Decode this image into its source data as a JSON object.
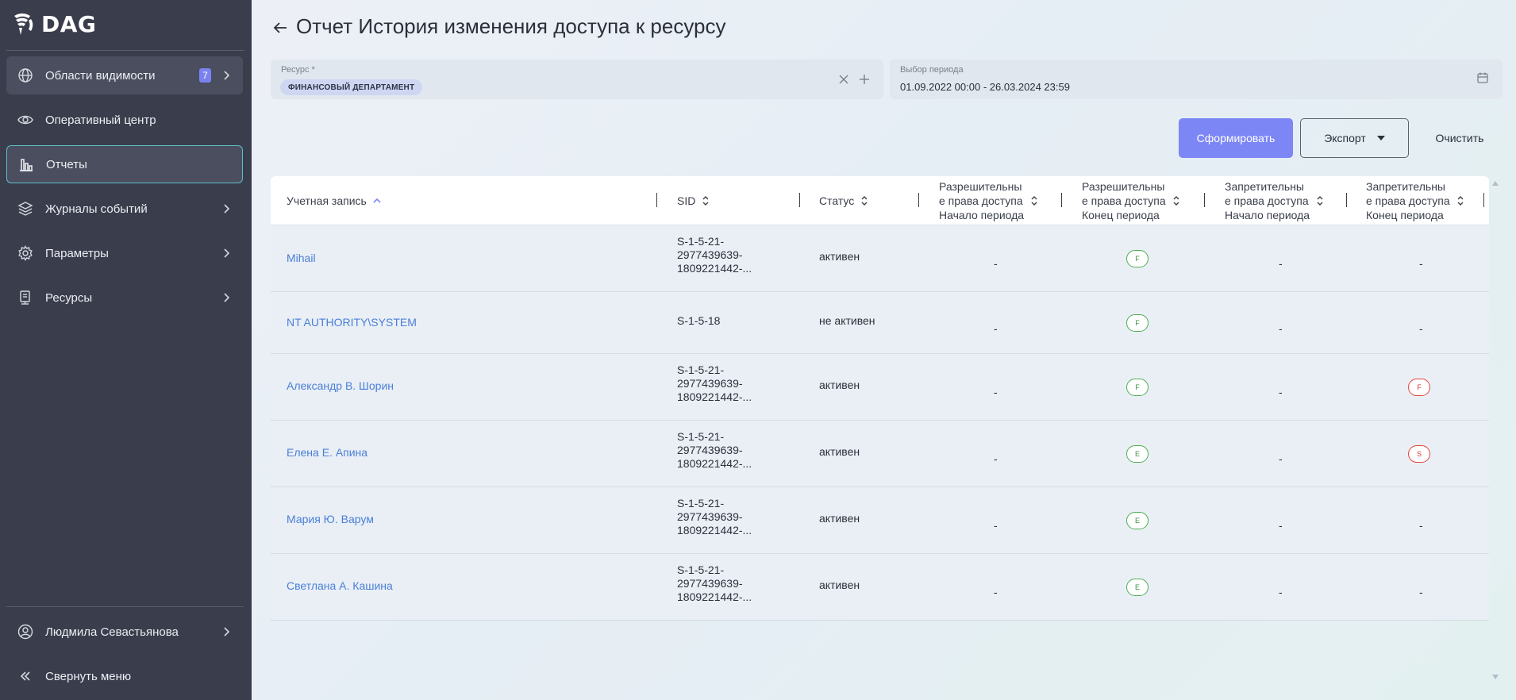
{
  "app": {
    "logo_text": "DAG"
  },
  "sidebar": {
    "items": [
      {
        "label": "Области видимости",
        "badge": "7"
      },
      {
        "label": "Оперативный центр"
      },
      {
        "label": "Отчеты"
      },
      {
        "label": "Журналы событий"
      },
      {
        "label": "Параметры"
      },
      {
        "label": "Ресурсы"
      }
    ],
    "user": "Людмила Севастьянова",
    "collapse": "Свернуть меню"
  },
  "header": {
    "title": "Отчет История изменения доступа к ресурсу"
  },
  "filters": {
    "resource_label": "Ресурс *",
    "resource_chip": "ФИНАНСОВЫЙ ДЕПАРТАМЕНТ",
    "period_label": "Выбор периода",
    "period_value": "01.09.2022 00:00 - 26.03.2024 23:59"
  },
  "actions": {
    "generate": "Сформировать",
    "export": "Экспорт",
    "clear": "Очистить"
  },
  "table": {
    "columns": [
      {
        "line1": "Учетная запись"
      },
      {
        "line1": "SID"
      },
      {
        "line1": "Статус"
      },
      {
        "line1": "Разрешительны",
        "line2": "е права доступа",
        "line3": "Начало периода"
      },
      {
        "line1": "Разрешительны",
        "line2": "е права доступа",
        "line3": "Конец периода"
      },
      {
        "line1": "Запретительны",
        "line2": "е права доступа",
        "line3": "Начало периода"
      },
      {
        "line1": "Запретительны",
        "line2": "е права доступа",
        "line3": "Конец периода"
      }
    ],
    "rows": [
      {
        "account": "Mihail",
        "sid": [
          "S-1-5-21-",
          "2977439639-",
          "1809221442-..."
        ],
        "status": "активен",
        "allow_start": "-",
        "allow_end": "F",
        "deny_start": "-",
        "deny_end": "-"
      },
      {
        "account": "NT AUTHORITY\\SYSTEM",
        "sid": [
          "S-1-5-18"
        ],
        "status": "не активен",
        "allow_start": "-",
        "allow_end": "F",
        "deny_start": "-",
        "deny_end": "-"
      },
      {
        "account": "Александр В. Шорин",
        "sid": [
          "S-1-5-21-",
          "2977439639-",
          "1809221442-..."
        ],
        "status": "активен",
        "allow_start": "-",
        "allow_end": "F",
        "deny_start": "-",
        "deny_end": "F"
      },
      {
        "account": "Елена Е. Апина",
        "sid": [
          "S-1-5-21-",
          "2977439639-",
          "1809221442-..."
        ],
        "status": "активен",
        "allow_start": "-",
        "allow_end": "E",
        "deny_start": "-",
        "deny_end": "S"
      },
      {
        "account": "Мария Ю. Варум",
        "sid": [
          "S-1-5-21-",
          "2977439639-",
          "1809221442-..."
        ],
        "status": "активен",
        "allow_start": "-",
        "allow_end": "E",
        "deny_start": "-",
        "deny_end": "-"
      },
      {
        "account": "Светлана А. Кашина",
        "sid": [
          "S-1-5-21-",
          "2977439639-",
          "1809221442-..."
        ],
        "status": "активен",
        "allow_start": "-",
        "allow_end": "E",
        "deny_start": "-",
        "deny_end": "-"
      }
    ]
  },
  "colors": {
    "accent": "#7c86f5",
    "link": "#4a7fd6",
    "sidebar": "#3a3d4c",
    "active_border": "#5cc0c8",
    "allow": "#4caf50",
    "deny": "#e5453a"
  }
}
